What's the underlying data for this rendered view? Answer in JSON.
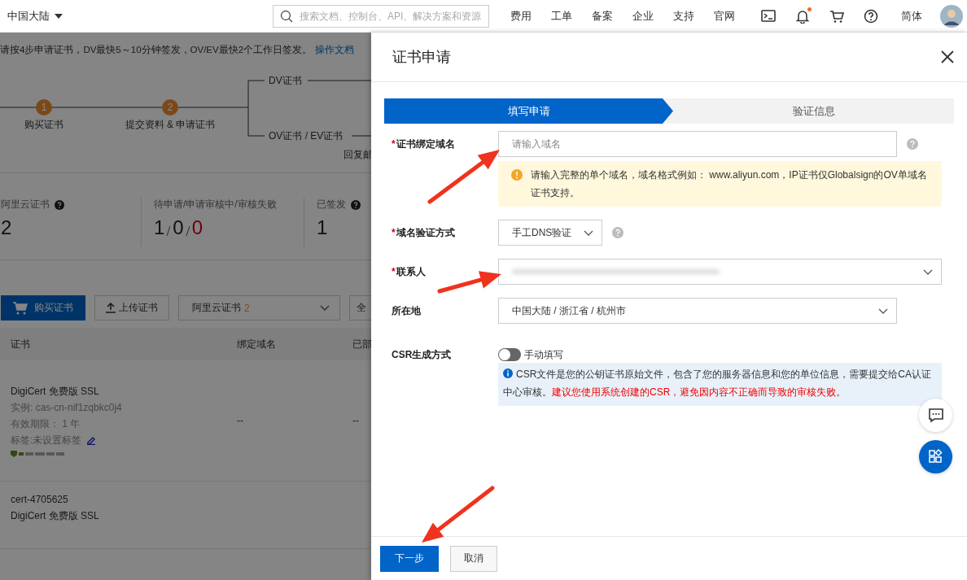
{
  "top_nav": {
    "region": "中国大陆",
    "search": {
      "placeholder": "搜索文档、控制台、API、解决方案和资源"
    },
    "links": [
      "费用",
      "工单",
      "备案",
      "企业",
      "支持",
      "官网"
    ],
    "icons": [
      {
        "kind": "terminal",
        "badge": false
      },
      {
        "kind": "bell",
        "badge": true
      },
      {
        "kind": "cart",
        "badge": false
      },
      {
        "kind": "help",
        "badge": false
      }
    ],
    "language": "简体"
  },
  "background_page": {
    "notice": "请按4步申请证书，DV最快5～10分钟签发，OV/EV最快2个工作日签发。",
    "notice_link": "操作文档",
    "flow": {
      "steps": [
        {
          "number": "1",
          "label": "购买证书"
        },
        {
          "number": "2",
          "label": "提交资料 & 申请证书"
        }
      ],
      "branches": [
        "DV证书",
        "OV证书 / EV证书"
      ],
      "note": "回复邮"
    },
    "stats": [
      {
        "label": "阿里云证书",
        "help": true,
        "parts": [
          {
            "text": "2",
            "alert": false
          }
        ]
      },
      {
        "label": "待申请/申请审核中/审核失败",
        "help": false,
        "parts": [
          {
            "text": "1",
            "alert": false
          },
          {
            "text": "0",
            "alert": false
          },
          {
            "text": "0",
            "alert": true
          }
        ]
      },
      {
        "label": "已签发",
        "help": true,
        "parts": [
          {
            "text": "1",
            "alert": false
          }
        ]
      }
    ],
    "toolbar": {
      "buy_button": "购买证书",
      "upload_button": "上传证书",
      "filter": {
        "value": "阿里云证书",
        "count": "2"
      },
      "filter_2": "全"
    },
    "table": {
      "columns": [
        "证书",
        "绑定域名",
        "已部"
      ],
      "rows": [
        {
          "cells": [
            {
              "lines": [
                "DigiCert 免费版 SSL",
                "实例: cas-cn-nif1zqbkc0j4",
                "有效期限： 1 年",
                "标签:未设置标签"
              ],
              "editable_tag": true
            },
            {
              "text": "--"
            },
            {
              "text": "--"
            }
          ]
        },
        {
          "cells": [
            {
              "lines": [
                "cert-4705625",
                "DigiCert 免费版 SSL"
              ],
              "editable_tag": false
            }
          ]
        }
      ]
    }
  },
  "drawer": {
    "title": "证书申请",
    "steps": [
      {
        "label": "填写申请",
        "selected": true
      },
      {
        "label": "验证信息",
        "selected": false
      }
    ],
    "fields": [
      {
        "kind": "input",
        "required_mark": "*",
        "label": "证书绑定域名",
        "placeholder": "请输入域名",
        "help": true,
        "compact": false,
        "warning": "请输入完整的单个域名，域名格式例如： www.aliyun.com，IP证书仅Globalsign的OV单域名证书支持。"
      },
      {
        "kind": "select",
        "required_mark": "*",
        "label": "域名验证方式",
        "value": "手工DNS验证",
        "help": true,
        "compact": true
      },
      {
        "kind": "select",
        "required_mark": "*",
        "label": "联系人",
        "redacted": true,
        "help": false,
        "compact": false
      },
      {
        "kind": "select",
        "label": "所在地",
        "value": "中国大陆 / 浙江省 / 杭州市",
        "help": false,
        "compact": false
      },
      {
        "kind": "toggle",
        "label": "CSR生成方式",
        "on": false,
        "toggle_label": "手动填写",
        "info": "CSR文件是您的公钥证书原始文件，包含了您的服务器信息和您的单位信息，需要提交给CA认证中心审核。",
        "info_alert": "建议您使用系统创建的CSR，避免因内容不正确而导致的审核失败。"
      }
    ],
    "float_buttons": [
      {
        "kind": "chat",
        "primary": false
      },
      {
        "kind": "apps",
        "primary": true
      }
    ],
    "buttons": [
      {
        "label": "下一步",
        "primary": true
      },
      {
        "label": "取消",
        "primary": false
      }
    ]
  }
}
